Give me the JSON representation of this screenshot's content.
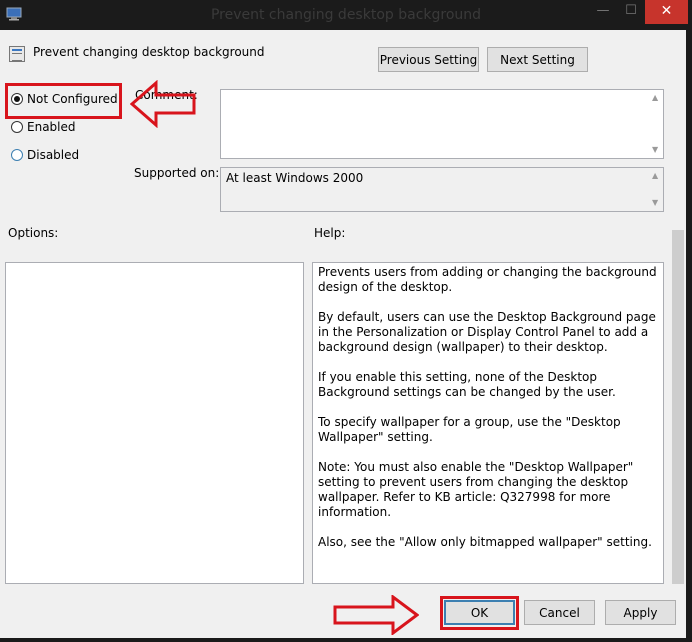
{
  "window": {
    "title": "Prevent changing desktop background",
    "minimize_glyph": "—",
    "maximize_glyph": "☐",
    "close_glyph": "✕"
  },
  "header": {
    "title": "Prevent changing desktop background",
    "previous_label": "Previous Setting",
    "next_label": "Next Setting"
  },
  "state": {
    "options": [
      {
        "label": "Not Configured",
        "checked": true
      },
      {
        "label": "Enabled",
        "checked": false
      },
      {
        "label": "Disabled",
        "checked": false
      }
    ]
  },
  "comment": {
    "label": "Comment:",
    "value": ""
  },
  "supported": {
    "label": "Supported on:",
    "value": "At least Windows 2000"
  },
  "options_label": "Options:",
  "help": {
    "label": "Help:",
    "paragraphs": [
      "Prevents users from adding or changing the background design of the desktop.",
      "By default, users can use the Desktop Background page in the Personalization or Display Control Panel to add a background design (wallpaper) to their desktop.",
      "If you enable this setting, none of the Desktop Background settings can be changed by the user.",
      "To specify wallpaper for a group, use the \"Desktop Wallpaper\" setting.",
      "Note: You must also enable the \"Desktop Wallpaper\" setting to prevent users from changing the desktop wallpaper. Refer to KB article: Q327998 for more information.",
      "Also, see the \"Allow only bitmapped wallpaper\" setting."
    ]
  },
  "footer": {
    "ok_label": "OK",
    "cancel_label": "Cancel",
    "apply_label": "Apply"
  },
  "annotation": {
    "color": "#d8141c"
  }
}
